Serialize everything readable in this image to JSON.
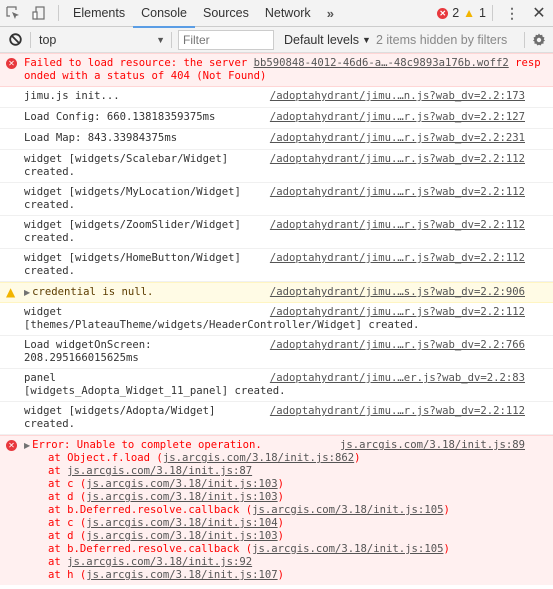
{
  "tabbar": {
    "tabs": [
      {
        "label": "Elements",
        "active": false
      },
      {
        "label": "Console",
        "active": true
      },
      {
        "label": "Sources",
        "active": false
      },
      {
        "label": "Network",
        "active": false
      }
    ],
    "more_label": "»",
    "error_count": "2",
    "warning_count": "1"
  },
  "filterbar": {
    "context": "top",
    "filter_placeholder": "Filter",
    "filter_value": "",
    "levels_label": "Default levels",
    "hidden_note": "2 items hidden by filters"
  },
  "messages": [
    {
      "level": "error",
      "text": "Failed to load resource: the server ",
      "link": "bb590848-4012-46d6-a…-48c9893a176b.woff2",
      "text2": " responded with a status of 404 (Not Found)"
    },
    {
      "level": "log",
      "text": "jimu.js init...",
      "source": "/adoptahydrant/jimu.…n.js?wab_dv=2.2:173"
    },
    {
      "level": "log",
      "text": "Load Config: 660.13818359375ms",
      "source": "/adoptahydrant/jimu.…r.js?wab_dv=2.2:127"
    },
    {
      "level": "log",
      "text": "Load Map: 843.33984375ms",
      "source": "/adoptahydrant/jimu.…r.js?wab_dv=2.2:231"
    },
    {
      "level": "log",
      "text": "widget [widgets/Scalebar/Widget]\ncreated.",
      "source": "/adoptahydrant/jimu.…r.js?wab_dv=2.2:112"
    },
    {
      "level": "log",
      "text": "widget [widgets/MyLocation/Widget]\ncreated.",
      "source": "/adoptahydrant/jimu.…r.js?wab_dv=2.2:112"
    },
    {
      "level": "log",
      "text": "widget [widgets/ZoomSlider/Widget]\ncreated.",
      "source": "/adoptahydrant/jimu.…r.js?wab_dv=2.2:112"
    },
    {
      "level": "log",
      "text": "widget [widgets/HomeButton/Widget]\ncreated.",
      "source": "/adoptahydrant/jimu.…r.js?wab_dv=2.2:112"
    },
    {
      "level": "warn",
      "text": "credential is null.",
      "source": "/adoptahydrant/jimu.…s.js?wab_dv=2.2:906"
    },
    {
      "level": "log",
      "text": "widget\n[themes/PlateauTheme/widgets/HeaderController/Widget] created.",
      "source": "/adoptahydrant/jimu.…r.js?wab_dv=2.2:112"
    },
    {
      "level": "log",
      "text": "Load widgetOnScreen:\n208.295166015625ms",
      "source": "/adoptahydrant/jimu.…r.js?wab_dv=2.2:766"
    },
    {
      "level": "log",
      "text": "panel\n[widgets_Adopta_Widget_11_panel] created.",
      "source": "/adoptahydrant/jimu.…er.js?wab_dv=2.2:83"
    },
    {
      "level": "log",
      "text": "widget [widgets/Adopta/Widget]\ncreated.",
      "source": "/adoptahydrant/jimu.…r.js?wab_dv=2.2:112"
    }
  ],
  "error_trace": {
    "text": "Error: Unable to complete operation.",
    "source": "js.arcgis.com/3.18/init.js:89",
    "stack": [
      {
        "prefix": "at Object.f.load (",
        "link": "js.arcgis.com/3.18/init.js:862",
        "suffix": ")"
      },
      {
        "prefix": "at ",
        "link": "js.arcgis.com/3.18/init.js:87",
        "suffix": ""
      },
      {
        "prefix": "at c (",
        "link": "js.arcgis.com/3.18/init.js:103",
        "suffix": ")"
      },
      {
        "prefix": "at d (",
        "link": "js.arcgis.com/3.18/init.js:103",
        "suffix": ")"
      },
      {
        "prefix": "at b.Deferred.resolve.callback (",
        "link": "js.arcgis.com/3.18/init.js:105",
        "suffix": ")"
      },
      {
        "prefix": "at c (",
        "link": "js.arcgis.com/3.18/init.js:104",
        "suffix": ")"
      },
      {
        "prefix": "at d (",
        "link": "js.arcgis.com/3.18/init.js:103",
        "suffix": ")"
      },
      {
        "prefix": "at b.Deferred.resolve.callback (",
        "link": "js.arcgis.com/3.18/init.js:105",
        "suffix": ")"
      },
      {
        "prefix": "at ",
        "link": "js.arcgis.com/3.18/init.js:92",
        "suffix": ""
      },
      {
        "prefix": "at h (",
        "link": "js.arcgis.com/3.18/init.js:107",
        "suffix": ")"
      }
    ]
  },
  "icons": {
    "inspect": "inspect-element-icon",
    "device": "device-toolbar-icon",
    "clear": "clear-console-icon",
    "settings": "gear-icon",
    "menu": "kebab-menu-icon",
    "close": "close-icon"
  }
}
